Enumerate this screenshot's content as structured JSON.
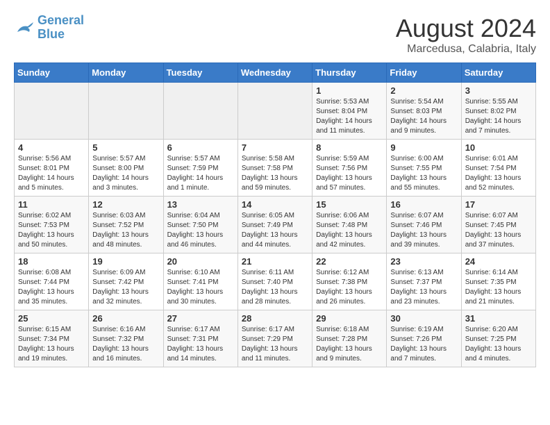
{
  "header": {
    "logo": {
      "line1": "General",
      "line2": "Blue"
    },
    "title": "August 2024",
    "subtitle": "Marcedusa, Calabria, Italy"
  },
  "weekdays": [
    "Sunday",
    "Monday",
    "Tuesday",
    "Wednesday",
    "Thursday",
    "Friday",
    "Saturday"
  ],
  "weeks": [
    [
      {
        "day": "",
        "info": ""
      },
      {
        "day": "",
        "info": ""
      },
      {
        "day": "",
        "info": ""
      },
      {
        "day": "",
        "info": ""
      },
      {
        "day": "1",
        "info": "Sunrise: 5:53 AM\nSunset: 8:04 PM\nDaylight: 14 hours\nand 11 minutes."
      },
      {
        "day": "2",
        "info": "Sunrise: 5:54 AM\nSunset: 8:03 PM\nDaylight: 14 hours\nand 9 minutes."
      },
      {
        "day": "3",
        "info": "Sunrise: 5:55 AM\nSunset: 8:02 PM\nDaylight: 14 hours\nand 7 minutes."
      }
    ],
    [
      {
        "day": "4",
        "info": "Sunrise: 5:56 AM\nSunset: 8:01 PM\nDaylight: 14 hours\nand 5 minutes."
      },
      {
        "day": "5",
        "info": "Sunrise: 5:57 AM\nSunset: 8:00 PM\nDaylight: 14 hours\nand 3 minutes."
      },
      {
        "day": "6",
        "info": "Sunrise: 5:57 AM\nSunset: 7:59 PM\nDaylight: 14 hours\nand 1 minute."
      },
      {
        "day": "7",
        "info": "Sunrise: 5:58 AM\nSunset: 7:58 PM\nDaylight: 13 hours\nand 59 minutes."
      },
      {
        "day": "8",
        "info": "Sunrise: 5:59 AM\nSunset: 7:56 PM\nDaylight: 13 hours\nand 57 minutes."
      },
      {
        "day": "9",
        "info": "Sunrise: 6:00 AM\nSunset: 7:55 PM\nDaylight: 13 hours\nand 55 minutes."
      },
      {
        "day": "10",
        "info": "Sunrise: 6:01 AM\nSunset: 7:54 PM\nDaylight: 13 hours\nand 52 minutes."
      }
    ],
    [
      {
        "day": "11",
        "info": "Sunrise: 6:02 AM\nSunset: 7:53 PM\nDaylight: 13 hours\nand 50 minutes."
      },
      {
        "day": "12",
        "info": "Sunrise: 6:03 AM\nSunset: 7:52 PM\nDaylight: 13 hours\nand 48 minutes."
      },
      {
        "day": "13",
        "info": "Sunrise: 6:04 AM\nSunset: 7:50 PM\nDaylight: 13 hours\nand 46 minutes."
      },
      {
        "day": "14",
        "info": "Sunrise: 6:05 AM\nSunset: 7:49 PM\nDaylight: 13 hours\nand 44 minutes."
      },
      {
        "day": "15",
        "info": "Sunrise: 6:06 AM\nSunset: 7:48 PM\nDaylight: 13 hours\nand 42 minutes."
      },
      {
        "day": "16",
        "info": "Sunrise: 6:07 AM\nSunset: 7:46 PM\nDaylight: 13 hours\nand 39 minutes."
      },
      {
        "day": "17",
        "info": "Sunrise: 6:07 AM\nSunset: 7:45 PM\nDaylight: 13 hours\nand 37 minutes."
      }
    ],
    [
      {
        "day": "18",
        "info": "Sunrise: 6:08 AM\nSunset: 7:44 PM\nDaylight: 13 hours\nand 35 minutes."
      },
      {
        "day": "19",
        "info": "Sunrise: 6:09 AM\nSunset: 7:42 PM\nDaylight: 13 hours\nand 32 minutes."
      },
      {
        "day": "20",
        "info": "Sunrise: 6:10 AM\nSunset: 7:41 PM\nDaylight: 13 hours\nand 30 minutes."
      },
      {
        "day": "21",
        "info": "Sunrise: 6:11 AM\nSunset: 7:40 PM\nDaylight: 13 hours\nand 28 minutes."
      },
      {
        "day": "22",
        "info": "Sunrise: 6:12 AM\nSunset: 7:38 PM\nDaylight: 13 hours\nand 26 minutes."
      },
      {
        "day": "23",
        "info": "Sunrise: 6:13 AM\nSunset: 7:37 PM\nDaylight: 13 hours\nand 23 minutes."
      },
      {
        "day": "24",
        "info": "Sunrise: 6:14 AM\nSunset: 7:35 PM\nDaylight: 13 hours\nand 21 minutes."
      }
    ],
    [
      {
        "day": "25",
        "info": "Sunrise: 6:15 AM\nSunset: 7:34 PM\nDaylight: 13 hours\nand 19 minutes."
      },
      {
        "day": "26",
        "info": "Sunrise: 6:16 AM\nSunset: 7:32 PM\nDaylight: 13 hours\nand 16 minutes."
      },
      {
        "day": "27",
        "info": "Sunrise: 6:17 AM\nSunset: 7:31 PM\nDaylight: 13 hours\nand 14 minutes."
      },
      {
        "day": "28",
        "info": "Sunrise: 6:17 AM\nSunset: 7:29 PM\nDaylight: 13 hours\nand 11 minutes."
      },
      {
        "day": "29",
        "info": "Sunrise: 6:18 AM\nSunset: 7:28 PM\nDaylight: 13 hours\nand 9 minutes."
      },
      {
        "day": "30",
        "info": "Sunrise: 6:19 AM\nSunset: 7:26 PM\nDaylight: 13 hours\nand 7 minutes."
      },
      {
        "day": "31",
        "info": "Sunrise: 6:20 AM\nSunset: 7:25 PM\nDaylight: 13 hours\nand 4 minutes."
      }
    ]
  ]
}
